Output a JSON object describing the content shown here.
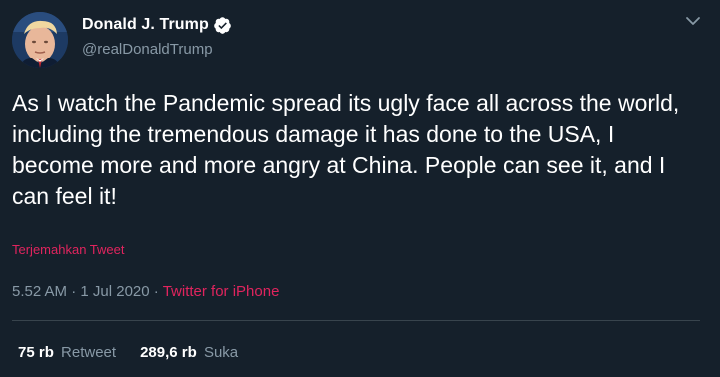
{
  "author": {
    "display_name": "Donald J. Trump",
    "handle": "@realDonaldTrump",
    "verified": true
  },
  "tweet": {
    "text": "As I watch the Pandemic spread its ugly face all across the world, including the tremendous damage it has done to the USA, I become more and more angry at China. People can see it, and I can feel it!",
    "translate_label": "Terjemahkan Tweet",
    "time": "5.52 AM",
    "date": "1 Jul 2020",
    "separator": "·",
    "source": "Twitter for iPhone"
  },
  "stats": {
    "retweets_count": "75 rb",
    "retweets_label": "Retweet",
    "likes_count": "289,6 rb",
    "likes_label": "Suka"
  },
  "icons": {
    "verified": "verified-badge-icon",
    "menu": "chevron-down-icon"
  },
  "colors": {
    "background": "#15202b",
    "primary_text": "#ffffff",
    "secondary_text": "#8899a6",
    "link": "#e0245e",
    "divider": "#38444d"
  }
}
